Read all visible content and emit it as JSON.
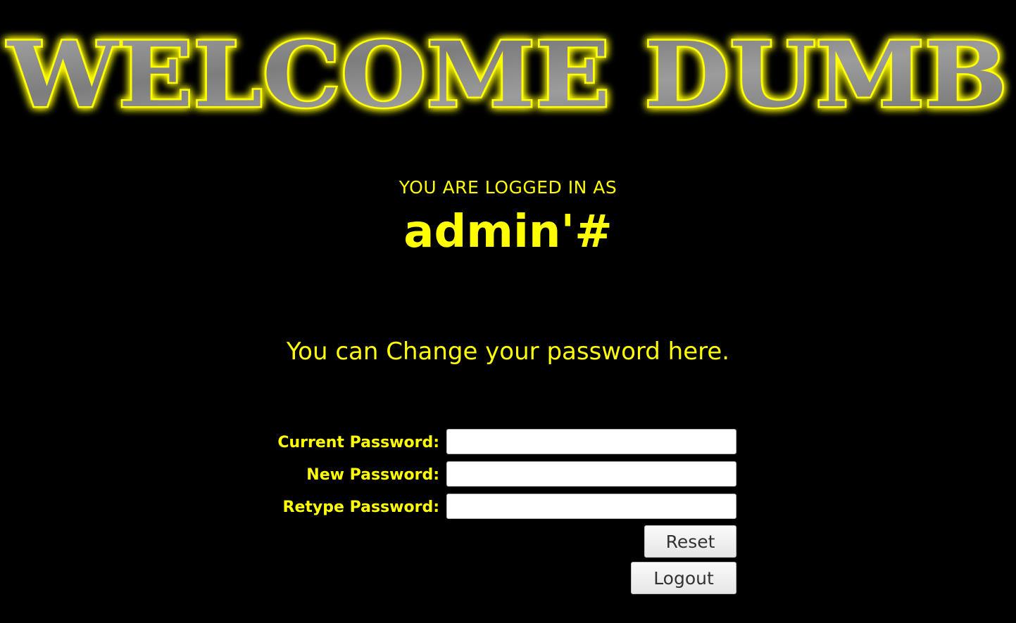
{
  "banner": {
    "text": "WELCOME DUMB",
    "fill_color": "#8c8c8c",
    "glow_color": "#ffff00"
  },
  "session": {
    "logged_in_label": "YOU ARE LOGGED IN AS",
    "username": "admin'#"
  },
  "message": "You can Change your password here.",
  "form": {
    "current_password_label": "Current Password:",
    "current_password_value": "",
    "new_password_label": "New Password:",
    "new_password_value": "",
    "retype_password_label": "Retype Password:",
    "retype_password_value": "",
    "reset_label": "Reset",
    "logout_label": "Logout"
  },
  "colors": {
    "background": "#000000",
    "text": "#ffff00"
  }
}
